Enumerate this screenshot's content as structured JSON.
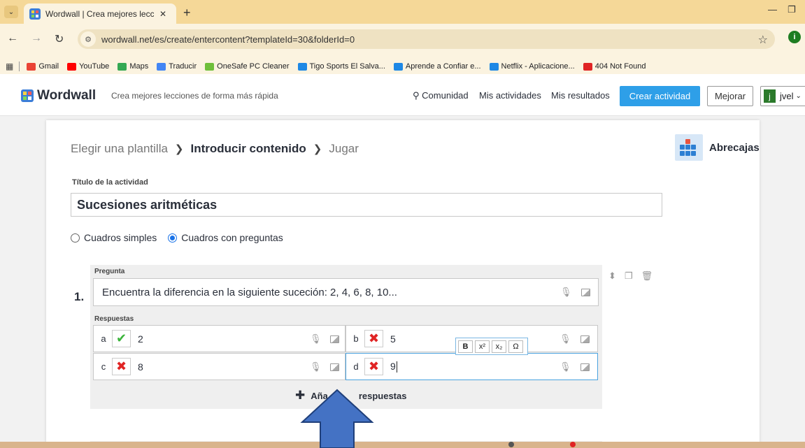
{
  "browser": {
    "tab_title": "Wordwall | Crea mejores leccion",
    "tab_close": "✕",
    "new_tab": "+",
    "url": "wordwall.net/es/create/entercontent?templateId=30&folderId=0",
    "profile_letter": "i",
    "bookmarks": [
      {
        "label": "Gmail",
        "color": "#ea4335"
      },
      {
        "label": "YouTube",
        "color": "#ff0000"
      },
      {
        "label": "Maps",
        "color": "#34a853"
      },
      {
        "label": "Traducir",
        "color": "#4285f4"
      },
      {
        "label": "OneSafe PC Cleaner",
        "color": "#6fbf3a"
      },
      {
        "label": "Tigo Sports El Salva...",
        "color": "#1e88e5"
      },
      {
        "label": "Aprende a Confiar e...",
        "color": "#1e88e5"
      },
      {
        "label": "Netflix - Aplicacione...",
        "color": "#1e88e5"
      },
      {
        "label": "404 Not Found",
        "color": "#e02424"
      }
    ]
  },
  "header": {
    "logo": "Wordwall",
    "tagline": "Crea mejores lecciones de forma más rápida",
    "nav": {
      "community": "Comunidad",
      "my_activities": "Mis actividades",
      "my_results": "Mis resultados"
    },
    "create_button": "Crear actividad",
    "upgrade_button": "Mejorar",
    "user_initial": "j",
    "user_name": "jvel"
  },
  "breadcrumb": {
    "step1": "Elegir una plantilla",
    "step2": "Introducir contenido",
    "step3": "Jugar"
  },
  "template": {
    "name": "Abrecajas"
  },
  "form": {
    "title_label": "Título de la actividad",
    "title_value": "Sucesiones aritméticas",
    "mode_options": {
      "simple": "Cuadros simples",
      "questions": "Cuadros con preguntas"
    },
    "selected_mode": "questions"
  },
  "question": {
    "number": "1.",
    "label": "Pregunta",
    "text": "Encuentra la diferencia en la siguiente suceción: 2, 4, 6, 8, 10...",
    "answers_label": "Respuestas",
    "answers": [
      {
        "letter": "a",
        "text": "2",
        "correct": true
      },
      {
        "letter": "b",
        "text": "5",
        "correct": false
      },
      {
        "letter": "c",
        "text": "8",
        "correct": false
      },
      {
        "letter": "d",
        "text": "9",
        "correct": false
      }
    ],
    "add_more_left": "Aña",
    "add_more_right": "respuestas"
  },
  "format_bar": {
    "bold": "B",
    "superscript": "x²",
    "subscript": "x₂",
    "symbol": "Ω"
  },
  "colors": {
    "accent": "#2e9fe8",
    "correct": "#3bb43b",
    "incorrect": "#e02424",
    "arrow_fill": "#4472c4"
  }
}
